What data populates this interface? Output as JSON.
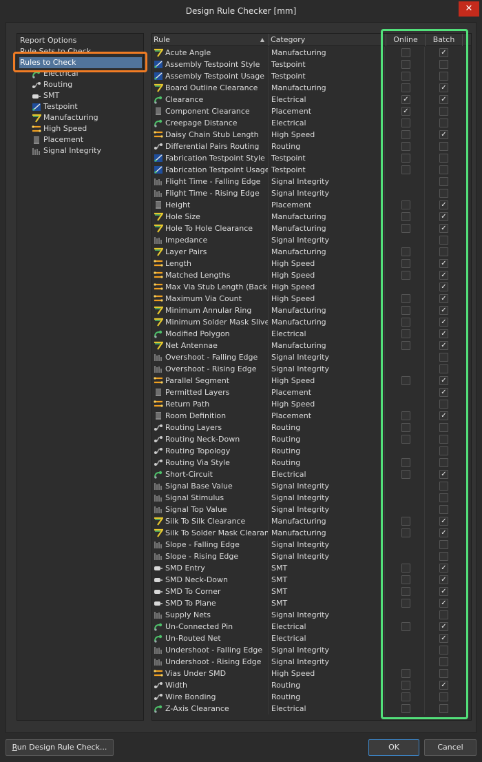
{
  "window": {
    "title": "Design Rule Checker [mm]"
  },
  "tree": [
    {
      "label": "Report Options",
      "icon": "",
      "indent": 0
    },
    {
      "label": "Rule Sets to Check",
      "icon": "",
      "indent": 0
    },
    {
      "label": "Rules to Check",
      "icon": "",
      "indent": 0,
      "selected": true
    },
    {
      "label": "Electrical",
      "icon": "electrical-icon",
      "indent": 1
    },
    {
      "label": "Routing",
      "icon": "routing-icon",
      "indent": 1
    },
    {
      "label": "SMT",
      "icon": "smt-icon",
      "indent": 1
    },
    {
      "label": "Testpoint",
      "icon": "testpoint-icon",
      "indent": 1
    },
    {
      "label": "Manufacturing",
      "icon": "manufacturing-icon",
      "indent": 1
    },
    {
      "label": "High Speed",
      "icon": "highspeed-icon",
      "indent": 1
    },
    {
      "label": "Placement",
      "icon": "placement-icon",
      "indent": 1
    },
    {
      "label": "Signal Integrity",
      "icon": "signal-integrity-icon",
      "indent": 1
    }
  ],
  "columns": {
    "rule": "Rule",
    "category": "Category",
    "online": "Online",
    "batch": "Batch"
  },
  "rules": [
    {
      "name": "Acute Angle",
      "category": "Manufacturing",
      "icon": "manufacturing-icon",
      "online": false,
      "batch": true
    },
    {
      "name": "Assembly Testpoint Style",
      "category": "Testpoint",
      "icon": "testpoint-icon",
      "online": false,
      "batch": false
    },
    {
      "name": "Assembly Testpoint Usage",
      "category": "Testpoint",
      "icon": "testpoint-icon",
      "online": false,
      "batch": false
    },
    {
      "name": "Board Outline Clearance",
      "category": "Manufacturing",
      "icon": "manufacturing-icon",
      "online": false,
      "batch": true
    },
    {
      "name": "Clearance",
      "category": "Electrical",
      "icon": "electrical-icon",
      "online": true,
      "batch": true
    },
    {
      "name": "Component Clearance",
      "category": "Placement",
      "icon": "placement-icon",
      "online": true,
      "batch": false
    },
    {
      "name": "Creepage Distance",
      "category": "Electrical",
      "icon": "electrical-icon",
      "online": false,
      "batch": false
    },
    {
      "name": "Daisy Chain Stub Length",
      "category": "High Speed",
      "icon": "highspeed-icon",
      "online": false,
      "batch": true
    },
    {
      "name": "Differential Pairs Routing",
      "category": "Routing",
      "icon": "routing-icon",
      "online": false,
      "batch": false
    },
    {
      "name": "Fabrication Testpoint Style",
      "category": "Testpoint",
      "icon": "testpoint-icon",
      "online": false,
      "batch": false
    },
    {
      "name": "Fabrication Testpoint Usage",
      "category": "Testpoint",
      "icon": "testpoint-icon",
      "online": false,
      "batch": false
    },
    {
      "name": "Flight Time - Falling Edge",
      "category": "Signal Integrity",
      "icon": "signal-integrity-icon",
      "online": null,
      "batch": false
    },
    {
      "name": "Flight Time - Rising Edge",
      "category": "Signal Integrity",
      "icon": "signal-integrity-icon",
      "online": null,
      "batch": false
    },
    {
      "name": "Height",
      "category": "Placement",
      "icon": "placement-icon",
      "online": false,
      "batch": true
    },
    {
      "name": "Hole Size",
      "category": "Manufacturing",
      "icon": "manufacturing-icon",
      "online": false,
      "batch": true
    },
    {
      "name": "Hole To Hole Clearance",
      "category": "Manufacturing",
      "icon": "manufacturing-icon",
      "online": false,
      "batch": true
    },
    {
      "name": "Impedance",
      "category": "Signal Integrity",
      "icon": "signal-integrity-icon",
      "online": null,
      "batch": false
    },
    {
      "name": "Layer Pairs",
      "category": "Manufacturing",
      "icon": "manufacturing-icon",
      "online": false,
      "batch": false
    },
    {
      "name": "Length",
      "category": "High Speed",
      "icon": "highspeed-icon",
      "online": false,
      "batch": true
    },
    {
      "name": "Matched Lengths",
      "category": "High Speed",
      "icon": "highspeed-icon",
      "online": false,
      "batch": true
    },
    {
      "name": "Max Via Stub Length (Back Dr",
      "category": "High Speed",
      "icon": "highspeed-icon",
      "online": null,
      "batch": true
    },
    {
      "name": "Maximum Via Count",
      "category": "High Speed",
      "icon": "highspeed-icon",
      "online": false,
      "batch": true
    },
    {
      "name": "Minimum Annular Ring",
      "category": "Manufacturing",
      "icon": "manufacturing-icon",
      "online": false,
      "batch": true
    },
    {
      "name": "Minimum Solder Mask Sliver",
      "category": "Manufacturing",
      "icon": "manufacturing-icon",
      "online": false,
      "batch": true
    },
    {
      "name": "Modified Polygon",
      "category": "Electrical",
      "icon": "electrical-icon",
      "online": false,
      "batch": true
    },
    {
      "name": "Net Antennae",
      "category": "Manufacturing",
      "icon": "manufacturing-icon",
      "online": false,
      "batch": true
    },
    {
      "name": "Overshoot - Falling Edge",
      "category": "Signal Integrity",
      "icon": "signal-integrity-icon",
      "online": null,
      "batch": false
    },
    {
      "name": "Overshoot - Rising Edge",
      "category": "Signal Integrity",
      "icon": "signal-integrity-icon",
      "online": null,
      "batch": false
    },
    {
      "name": "Parallel Segment",
      "category": "High Speed",
      "icon": "highspeed-icon",
      "online": false,
      "batch": true
    },
    {
      "name": "Permitted Layers",
      "category": "Placement",
      "icon": "placement-icon",
      "online": null,
      "batch": true
    },
    {
      "name": "Return Path",
      "category": "High Speed",
      "icon": "highspeed-icon",
      "online": null,
      "batch": false
    },
    {
      "name": "Room Definition",
      "category": "Placement",
      "icon": "placement-icon",
      "online": false,
      "batch": true
    },
    {
      "name": "Routing Layers",
      "category": "Routing",
      "icon": "routing-icon",
      "online": false,
      "batch": false
    },
    {
      "name": "Routing Neck-Down",
      "category": "Routing",
      "icon": "routing-icon",
      "online": false,
      "batch": false
    },
    {
      "name": "Routing Topology",
      "category": "Routing",
      "icon": "routing-icon",
      "online": null,
      "batch": false
    },
    {
      "name": "Routing Via Style",
      "category": "Routing",
      "icon": "routing-icon",
      "online": false,
      "batch": false
    },
    {
      "name": "Short-Circuit",
      "category": "Electrical",
      "icon": "electrical-icon",
      "online": false,
      "batch": true
    },
    {
      "name": "Signal Base Value",
      "category": "Signal Integrity",
      "icon": "signal-integrity-icon",
      "online": null,
      "batch": false
    },
    {
      "name": "Signal Stimulus",
      "category": "Signal Integrity",
      "icon": "signal-integrity-icon",
      "online": null,
      "batch": false
    },
    {
      "name": "Signal Top Value",
      "category": "Signal Integrity",
      "icon": "signal-integrity-icon",
      "online": null,
      "batch": false
    },
    {
      "name": "Silk To Silk Clearance",
      "category": "Manufacturing",
      "icon": "manufacturing-icon",
      "online": false,
      "batch": true
    },
    {
      "name": "Silk To Solder Mask Clearance",
      "category": "Manufacturing",
      "icon": "manufacturing-icon",
      "online": false,
      "batch": true
    },
    {
      "name": "Slope - Falling Edge",
      "category": "Signal Integrity",
      "icon": "signal-integrity-icon",
      "online": null,
      "batch": false
    },
    {
      "name": "Slope - Rising Edge",
      "category": "Signal Integrity",
      "icon": "signal-integrity-icon",
      "online": null,
      "batch": false
    },
    {
      "name": "SMD Entry",
      "category": "SMT",
      "icon": "smt-icon",
      "online": false,
      "batch": true
    },
    {
      "name": "SMD Neck-Down",
      "category": "SMT",
      "icon": "smt-icon",
      "online": false,
      "batch": true
    },
    {
      "name": "SMD To Corner",
      "category": "SMT",
      "icon": "smt-icon",
      "online": false,
      "batch": true
    },
    {
      "name": "SMD To Plane",
      "category": "SMT",
      "icon": "smt-icon",
      "online": false,
      "batch": true
    },
    {
      "name": "Supply Nets",
      "category": "Signal Integrity",
      "icon": "signal-integrity-icon",
      "online": null,
      "batch": false
    },
    {
      "name": "Un-Connected Pin",
      "category": "Electrical",
      "icon": "electrical-icon",
      "online": false,
      "batch": true
    },
    {
      "name": "Un-Routed Net",
      "category": "Electrical",
      "icon": "electrical-icon",
      "online": null,
      "batch": true
    },
    {
      "name": "Undershoot - Falling Edge",
      "category": "Signal Integrity",
      "icon": "signal-integrity-icon",
      "online": null,
      "batch": false
    },
    {
      "name": "Undershoot - Rising Edge",
      "category": "Signal Integrity",
      "icon": "signal-integrity-icon",
      "online": null,
      "batch": false
    },
    {
      "name": "Vias Under SMD",
      "category": "High Speed",
      "icon": "highspeed-icon",
      "online": false,
      "batch": false
    },
    {
      "name": "Width",
      "category": "Routing",
      "icon": "routing-icon",
      "online": false,
      "batch": true
    },
    {
      "name": "Wire Bonding",
      "category": "Routing",
      "icon": "routing-icon",
      "online": false,
      "batch": false
    },
    {
      "name": "Z-Axis Clearance",
      "category": "Electrical",
      "icon": "electrical-icon",
      "online": false,
      "batch": false
    }
  ],
  "buttons": {
    "run_prefix": "R",
    "run_rest": "un Design Rule Check...",
    "ok": "OK",
    "cancel": "Cancel"
  },
  "colors": {
    "highlight_orange": "#f07c24",
    "highlight_green": "#52e07a",
    "selected": "#51749b",
    "close": "#c42b1c"
  }
}
